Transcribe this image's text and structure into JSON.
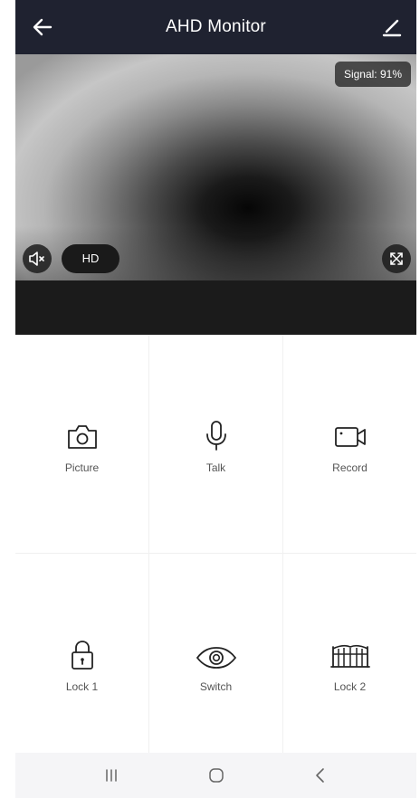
{
  "header": {
    "title": "AHD Monitor"
  },
  "video": {
    "signal": "Signal: 91%",
    "quality": "HD"
  },
  "controls": [
    {
      "label": "Picture",
      "icon": "camera-icon"
    },
    {
      "label": "Talk",
      "icon": "microphone-icon"
    },
    {
      "label": "Record",
      "icon": "video-camera-icon"
    },
    {
      "label": "Lock 1",
      "icon": "lock-icon"
    },
    {
      "label": "Switch",
      "icon": "eye-icon"
    },
    {
      "label": "Lock 2",
      "icon": "gate-icon"
    }
  ],
  "colors": {
    "header_bg": "#1f2230",
    "label": "#555555",
    "icon": "#222222"
  }
}
